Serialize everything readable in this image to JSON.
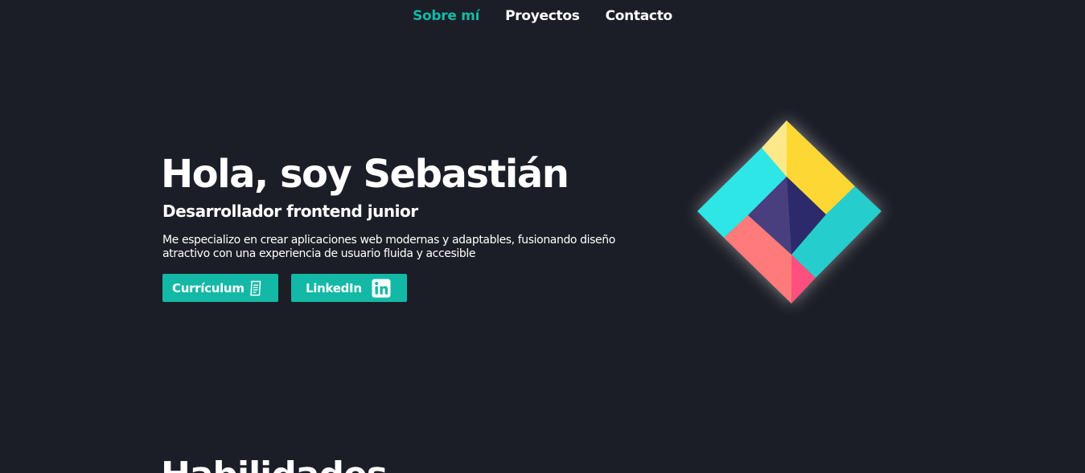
{
  "nav": {
    "items": [
      {
        "label": "Sobre mí",
        "active": true
      },
      {
        "label": "Proyectos",
        "active": false
      },
      {
        "label": "Contacto",
        "active": false
      }
    ]
  },
  "hero": {
    "title": "Hola, soy Sebastián",
    "subtitle": "Desarrollador frontend junior",
    "description": "Me especializo en crear aplicaciones web modernas y adaptables, fusionando diseño atractivo con una experiencia de usuario fluida y accesible",
    "buttons": {
      "cv_label": "Currículum",
      "cv_icon": "document-icon",
      "linkedin_label": "LinkedIn",
      "linkedin_icon": "linkedin-icon"
    }
  },
  "logo": {
    "icon": "diamond-logo",
    "colors": {
      "yellow": "#fdd835",
      "pale_yellow": "#ffe88a",
      "cyan": "#2ee6e6",
      "teal": "#26cdcd",
      "coral": "#ff7b7b",
      "pink": "#ff4f7e",
      "purple": "#4a3f7e",
      "navy": "#2c2a6b"
    }
  },
  "skills": {
    "title": "Habilidades"
  },
  "theme": {
    "background": "#1c1e27",
    "accent": "#14b8a6",
    "text": "#ffffff"
  }
}
